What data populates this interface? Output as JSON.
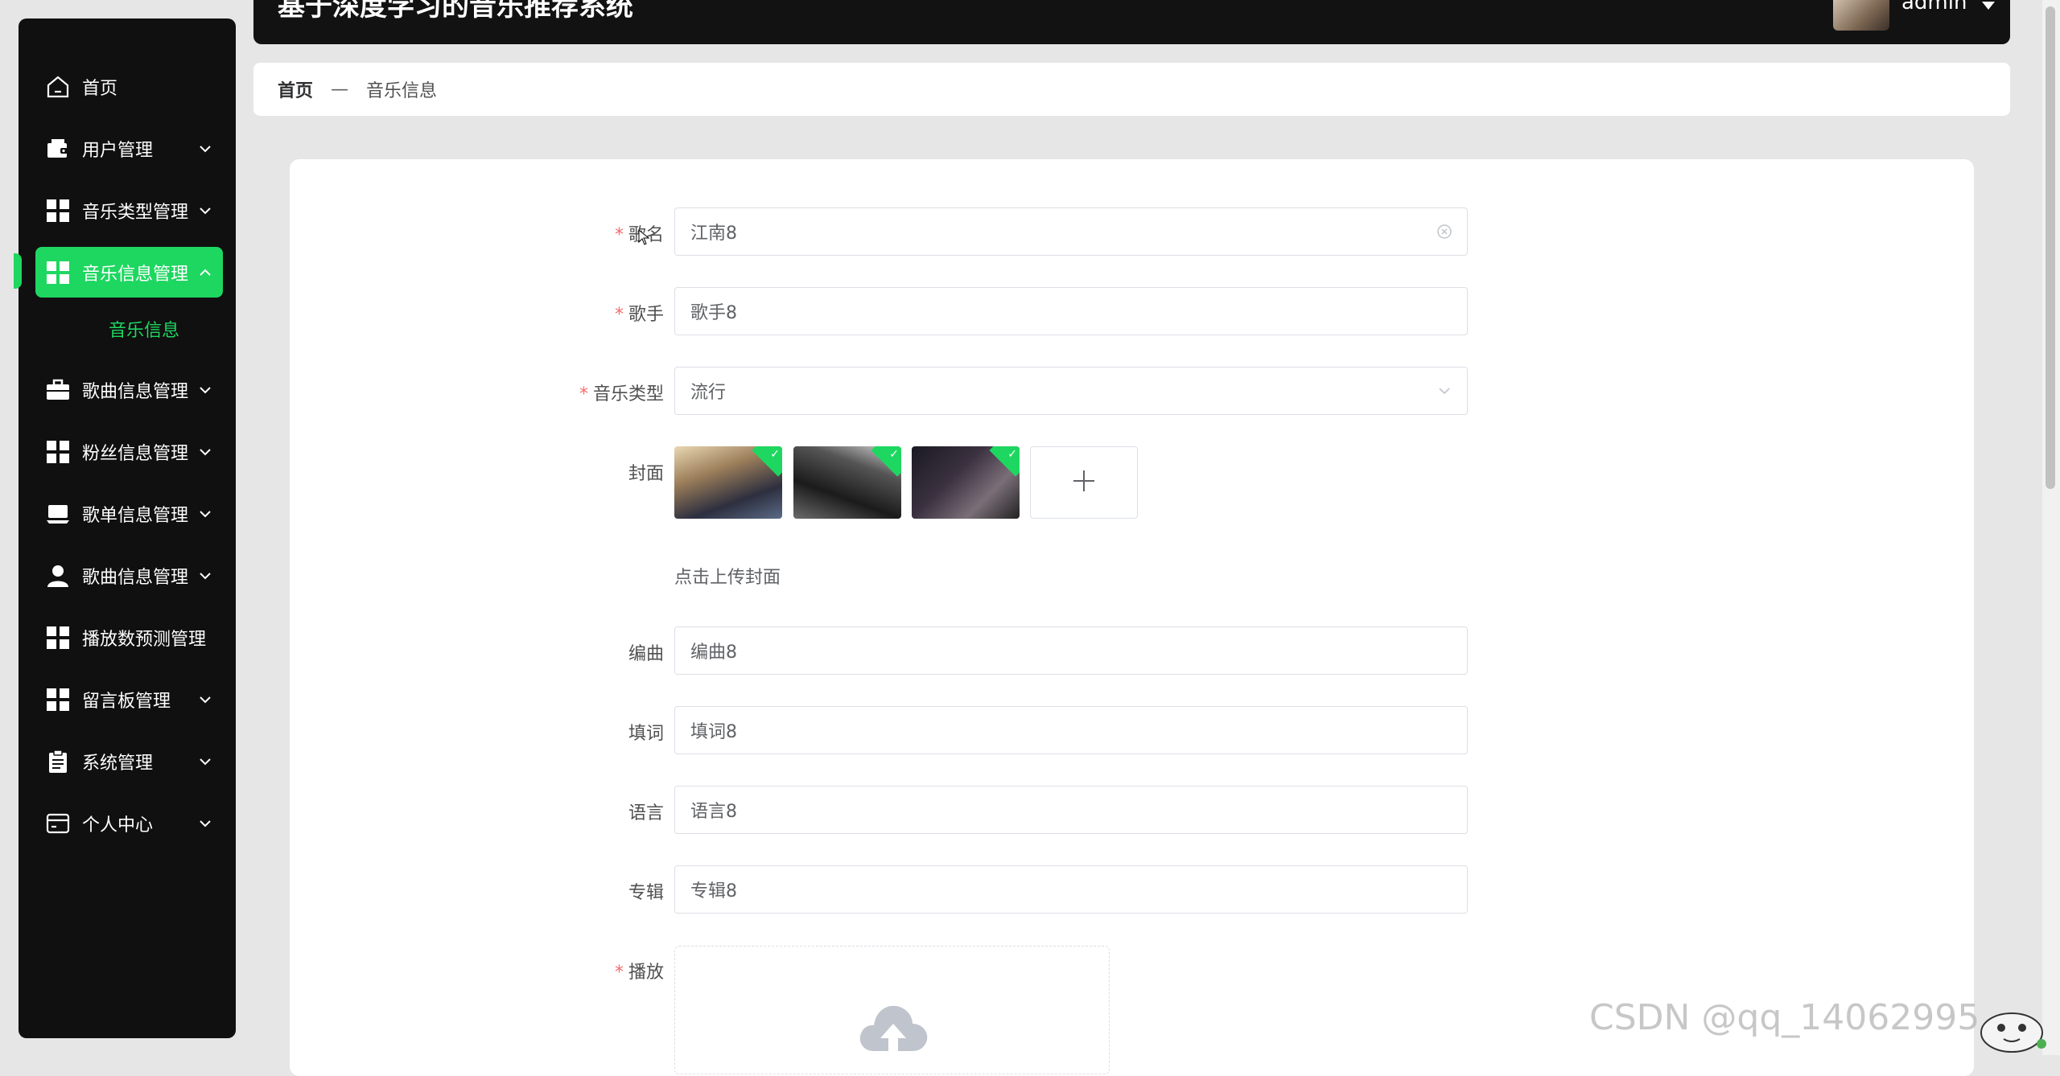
{
  "app": {
    "title": "基于深度学习的音乐推荐系统",
    "user": {
      "name": "admin"
    }
  },
  "sidebar": {
    "items": [
      {
        "label": "首页",
        "icon": "home-icon"
      },
      {
        "label": "用户管理",
        "icon": "wallet-icon"
      },
      {
        "label": "音乐类型管理",
        "icon": "grid-icon"
      },
      {
        "label": "音乐信息管理",
        "icon": "grid-icon",
        "active": true
      },
      {
        "label": "歌曲信息管理",
        "icon": "briefcase-icon"
      },
      {
        "label": "粉丝信息管理",
        "icon": "grid-icon"
      },
      {
        "label": "歌单信息管理",
        "icon": "laptop-icon"
      },
      {
        "label": "歌曲信息管理",
        "icon": "user-icon"
      },
      {
        "label": "播放数预测管理",
        "icon": "grid-icon"
      },
      {
        "label": "留言板管理",
        "icon": "grid-icon"
      },
      {
        "label": "系统管理",
        "icon": "clipboard-icon"
      },
      {
        "label": "个人中心",
        "icon": "card-icon"
      }
    ],
    "sub_item": "音乐信息"
  },
  "breadcrumb": {
    "home": "首页",
    "separator": "—",
    "current": "音乐信息"
  },
  "form": {
    "song_name": {
      "label": "歌名",
      "value": "江南8"
    },
    "singer": {
      "label": "歌手",
      "value": "歌手8"
    },
    "music_type": {
      "label": "音乐类型",
      "value": "流行"
    },
    "cover": {
      "label": "封面",
      "tip": "点击上传封面"
    },
    "composer": {
      "label": "编曲",
      "value": "编曲8"
    },
    "lyricist": {
      "label": "填词",
      "value": "填词8"
    },
    "language": {
      "label": "语言",
      "value": "语言8"
    },
    "album": {
      "label": "专辑",
      "value": "专辑8"
    },
    "play": {
      "label": "播放"
    }
  },
  "watermark": "CSDN @qq_14062995",
  "colors": {
    "accent": "#1ed760",
    "sidebar": "#101010",
    "required": "#f56c6c"
  }
}
